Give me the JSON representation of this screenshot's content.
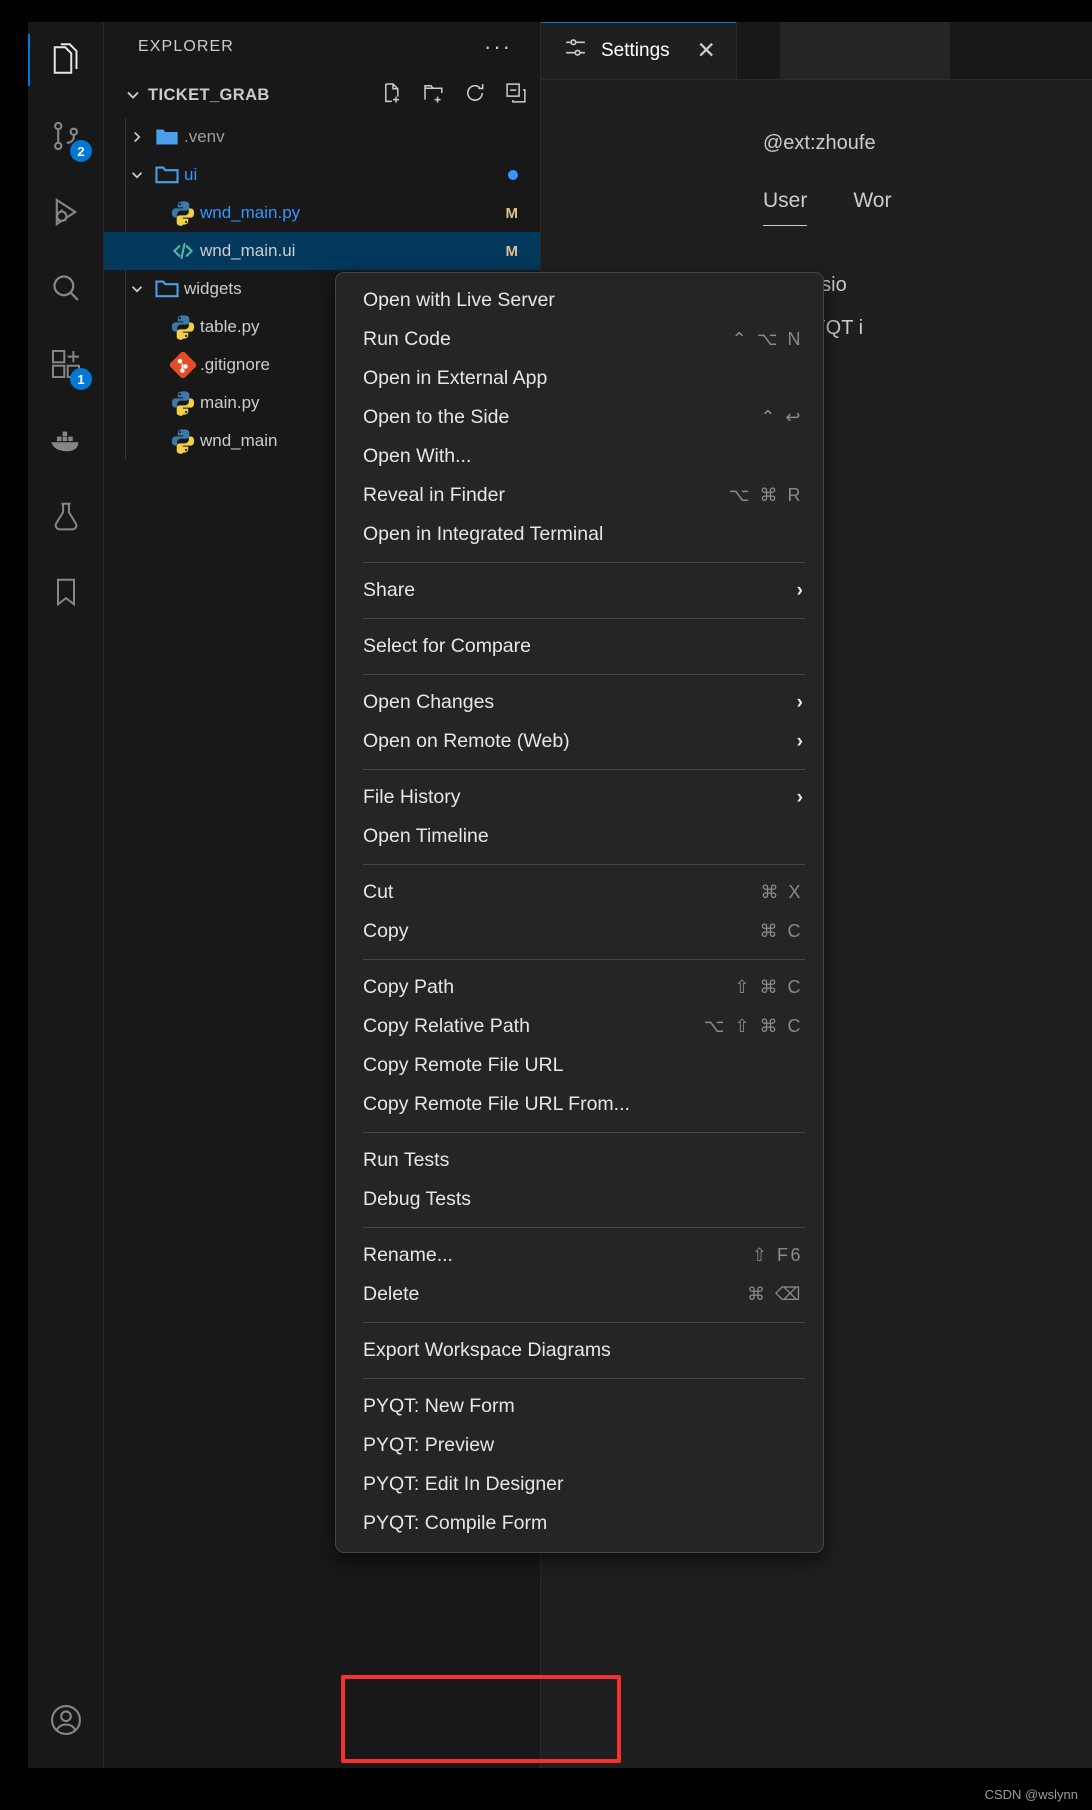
{
  "activity_bar": {
    "items": [
      {
        "name": "explorer",
        "icon": "files-icon",
        "badge": null,
        "active": true
      },
      {
        "name": "source-control",
        "icon": "source-control-icon",
        "badge": "2",
        "active": false
      },
      {
        "name": "run-and-debug",
        "icon": "run-debug-icon",
        "badge": null,
        "active": false
      },
      {
        "name": "search",
        "icon": "search-icon",
        "badge": null,
        "active": false
      },
      {
        "name": "extensions",
        "icon": "extensions-icon",
        "badge": "1",
        "active": false
      },
      {
        "name": "docker",
        "icon": "docker-whale-icon",
        "badge": null,
        "active": false
      },
      {
        "name": "testing",
        "icon": "beaker-icon",
        "badge": null,
        "active": false
      },
      {
        "name": "bookmarks",
        "icon": "bookmark-icon",
        "badge": null,
        "active": false
      }
    ],
    "bottom_items": [
      {
        "name": "accounts",
        "icon": "account-icon"
      }
    ]
  },
  "sidebar": {
    "title": "EXPLORER",
    "more_actions_label": "···",
    "root": {
      "label": "TICKET_GRAB",
      "expanded": true,
      "actions": [
        {
          "name": "new-file",
          "icon": "new-file-icon"
        },
        {
          "name": "new-folder",
          "icon": "new-folder-icon"
        },
        {
          "name": "refresh",
          "icon": "refresh-icon"
        },
        {
          "name": "collapse-all",
          "icon": "collapse-all-icon"
        }
      ]
    },
    "tree": [
      {
        "label": ".venv",
        "type": "folder",
        "level": 1,
        "expanded": false,
        "icon": "folder-filled-icon",
        "color": "dim",
        "badge": "",
        "selected": false
      },
      {
        "label": "ui",
        "type": "folder",
        "level": 1,
        "expanded": true,
        "icon": "folder-open-icon",
        "color": "blue",
        "badge": "dot",
        "selected": false
      },
      {
        "label": "wnd_main.py",
        "type": "file",
        "level": 2,
        "icon": "python-icon",
        "color": "blue",
        "badge": "M",
        "selected": false
      },
      {
        "label": "wnd_main.ui",
        "type": "file",
        "level": 2,
        "icon": "code-icon",
        "color": "normal",
        "badge": "M",
        "selected": true
      },
      {
        "label": "widgets",
        "type": "folder",
        "level": 1,
        "expanded": true,
        "icon": "folder-open-icon",
        "color": "normal",
        "badge": "",
        "selected": false
      },
      {
        "label": "table.py",
        "type": "file",
        "level": 2,
        "icon": "python-icon",
        "color": "normal",
        "badge": "",
        "selected": false
      },
      {
        "label": ".gitignore",
        "type": "file",
        "level": 1,
        "icon": "git-icon",
        "color": "normal",
        "badge": "",
        "selected": false
      },
      {
        "label": "main.py",
        "type": "file",
        "level": 1,
        "icon": "python-icon",
        "color": "normal",
        "badge": "",
        "selected": false
      },
      {
        "label": "wnd_main",
        "type": "file",
        "level": 1,
        "icon": "python-icon",
        "color": "normal",
        "badge": "",
        "selected": false
      }
    ]
  },
  "editor": {
    "tab": {
      "label": "Settings",
      "icon": "settings-gear-icon",
      "close_label": "✕"
    },
    "settings": {
      "search_value": "@ext:zhoufe",
      "tabs": [
        {
          "label": "User",
          "active": true
        },
        {
          "label": "Wor",
          "active": false
        }
      ],
      "section": "Extensio",
      "child": "PYQT i"
    }
  },
  "context_menu": {
    "groups": [
      {
        "items": [
          {
            "label": "Open with Live Server",
            "shortcut": "",
            "submenu": false
          },
          {
            "label": "Run Code",
            "shortcut": "⌃ ⌥ N",
            "submenu": false
          },
          {
            "label": "Open in External App",
            "shortcut": "",
            "submenu": false
          },
          {
            "label": "Open to the Side",
            "shortcut": "⌃ ↩",
            "submenu": false
          },
          {
            "label": "Open With...",
            "shortcut": "",
            "submenu": false
          },
          {
            "label": "Reveal in Finder",
            "shortcut": "⌥ ⌘ R",
            "submenu": false
          },
          {
            "label": "Open in Integrated Terminal",
            "shortcut": "",
            "submenu": false
          }
        ]
      },
      {
        "items": [
          {
            "label": "Share",
            "shortcut": "",
            "submenu": true
          }
        ]
      },
      {
        "items": [
          {
            "label": "Select for Compare",
            "shortcut": "",
            "submenu": false
          }
        ]
      },
      {
        "items": [
          {
            "label": "Open Changes",
            "shortcut": "",
            "submenu": true
          },
          {
            "label": "Open on Remote (Web)",
            "shortcut": "",
            "submenu": true
          }
        ]
      },
      {
        "items": [
          {
            "label": "File History",
            "shortcut": "",
            "submenu": true
          },
          {
            "label": "Open Timeline",
            "shortcut": "",
            "submenu": false
          }
        ]
      },
      {
        "items": [
          {
            "label": "Cut",
            "shortcut": "⌘ X",
            "submenu": false
          },
          {
            "label": "Copy",
            "shortcut": "⌘ C",
            "submenu": false
          }
        ]
      },
      {
        "items": [
          {
            "label": "Copy Path",
            "shortcut": "⇧ ⌘ C",
            "submenu": false
          },
          {
            "label": "Copy Relative Path",
            "shortcut": "⌥ ⇧ ⌘ C",
            "submenu": false
          },
          {
            "label": "Copy Remote File URL",
            "shortcut": "",
            "submenu": false
          },
          {
            "label": "Copy Remote File URL From...",
            "shortcut": "",
            "submenu": false
          }
        ]
      },
      {
        "items": [
          {
            "label": "Run Tests",
            "shortcut": "",
            "submenu": false
          },
          {
            "label": "Debug Tests",
            "shortcut": "",
            "submenu": false
          }
        ]
      },
      {
        "items": [
          {
            "label": "Rename...",
            "shortcut": "⇧ F6",
            "submenu": false
          },
          {
            "label": "Delete",
            "shortcut": "⌘ ⌫",
            "submenu": false
          }
        ]
      },
      {
        "items": [
          {
            "label": "Export Workspace Diagrams",
            "shortcut": "",
            "submenu": false
          }
        ]
      },
      {
        "items": [
          {
            "label": "PYQT: New Form",
            "shortcut": "",
            "submenu": false
          },
          {
            "label": "PYQT: Preview",
            "shortcut": "",
            "submenu": false
          },
          {
            "label": "PYQT: Edit In Designer",
            "shortcut": "",
            "submenu": false
          },
          {
            "label": "PYQT: Compile Form",
            "shortcut": "",
            "submenu": false
          }
        ]
      }
    ]
  },
  "annotation": {
    "highlight_color": "#f53131",
    "highlighted_items": [
      "PYQT: Edit In Designer",
      "PYQT: Compile Form"
    ]
  },
  "watermark": {
    "text": "CSDN @wslynn"
  }
}
